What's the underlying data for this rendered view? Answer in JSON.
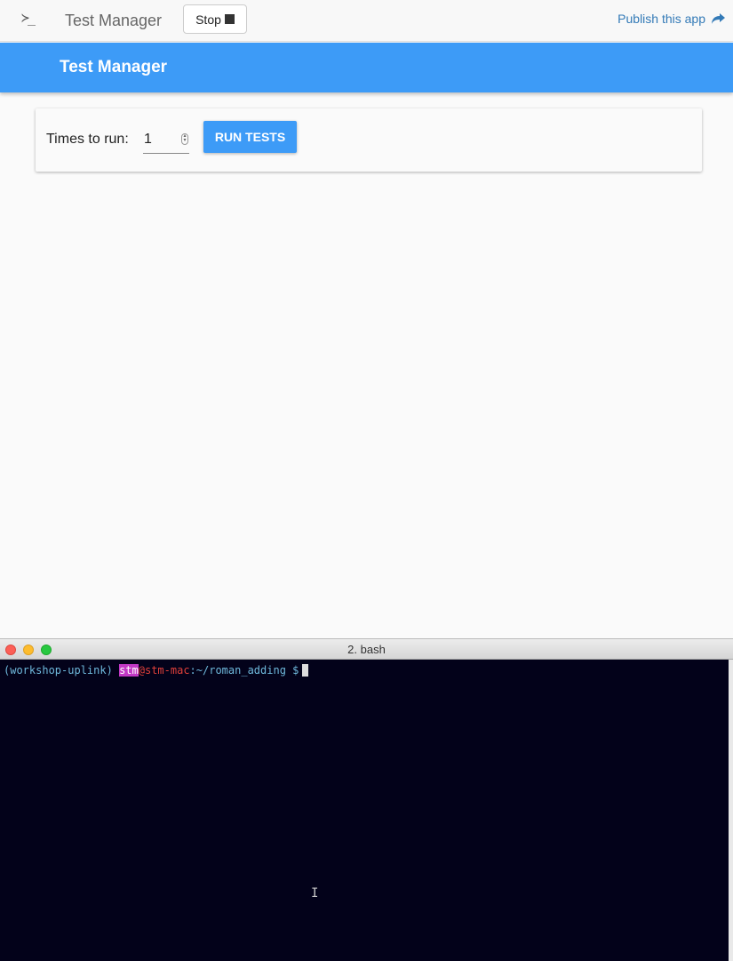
{
  "topbar": {
    "terminal_glyph": "≻_",
    "title": "Test Manager",
    "stop_label": "Stop",
    "publish_label": "Publish this app"
  },
  "app": {
    "header_title": "Test Manager",
    "times_label": "Times to run:",
    "times_value": "1",
    "run_label": "RUN TESTS"
  },
  "terminal": {
    "title": "2. bash",
    "prompt_env": "(workshop-uplink)",
    "prompt_user": "stm",
    "prompt_host": "@stm-mac",
    "prompt_path": ":~/roman_adding",
    "prompt_dollar": "$",
    "mouse_cursor": "I"
  },
  "colors": {
    "accent": "#3d9bf7",
    "terminal_bg": "#03021a",
    "link": "#337ab7"
  }
}
